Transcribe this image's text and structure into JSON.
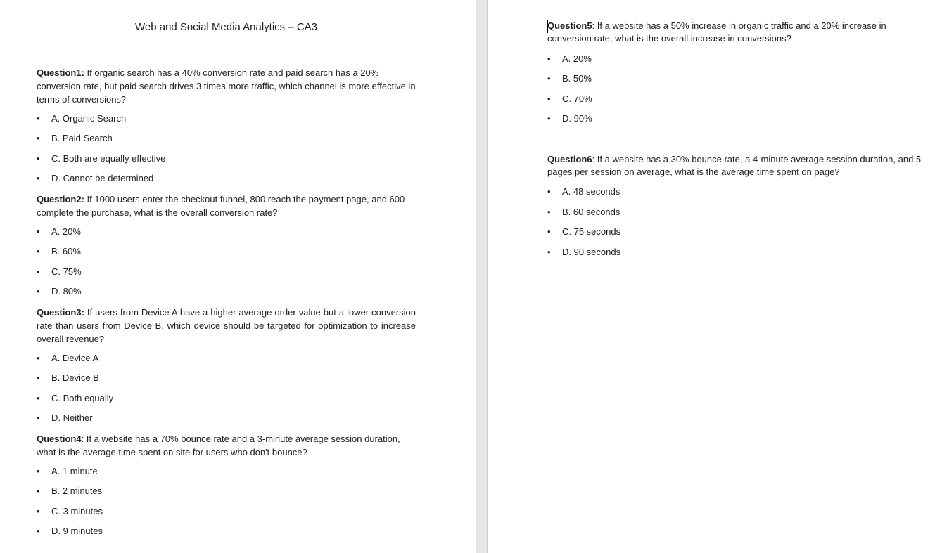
{
  "document": {
    "title": "Web and Social Media Analytics – CA3",
    "bullet": "•"
  },
  "questions": [
    {
      "label": "Question1:",
      "text": " If organic search has a 40% conversion rate and paid search has a 20% conversion rate, but paid search drives 3 times more traffic, which channel is more effective in terms of conversions?",
      "options": [
        "A. Organic Search",
        "B. Paid Search",
        "C. Both are equally effective",
        "D. Cannot be determined"
      ]
    },
    {
      "label": "Question2:",
      "text": " If 1000 users enter the checkout funnel, 800 reach the payment page, and 600 complete the purchase, what is the overall conversion rate?",
      "options": [
        "A. 20%",
        "B. 60%",
        "C. 75%",
        "D. 80%"
      ]
    },
    {
      "label": "Question3:",
      "text": " If users from Device A have a higher average order value but a lower conversion rate than users from Device B, which device should be targeted for optimization to increase overall revenue?",
      "options": [
        "A. Device A",
        "B. Device B",
        "C. Both equally",
        "D. Neither"
      ]
    },
    {
      "label": "Question4",
      "text": ": If a website has a 70% bounce rate and a 3-minute average session duration, what is the average time spent on site for users who don't bounce?",
      "options": [
        "A. 1 minute",
        "B. 2 minutes",
        "C. 3 minutes",
        "D. 9 minutes"
      ]
    },
    {
      "label": "Question5",
      "text": ": If a website has a 50% increase in organic traffic and a 20% increase in conversion rate, what is the overall increase in conversions?",
      "options": [
        "A. 20%",
        "B. 50%",
        "C. 70%",
        "D. 90%"
      ]
    },
    {
      "label": "Question6",
      "text": ": If a website has a 30% bounce rate, a 4-minute average session duration, and 5 pages per session on average, what is the average time spent on page?",
      "options": [
        "A. 48 seconds",
        "B. 60 seconds",
        "C. 75 seconds",
        "D. 90 seconds"
      ]
    }
  ]
}
